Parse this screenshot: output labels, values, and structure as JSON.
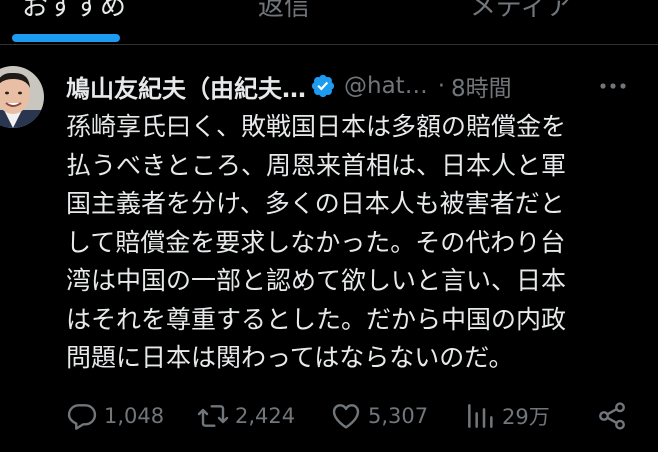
{
  "tabs": [
    {
      "label": "おすすめ"
    },
    {
      "label": "返信"
    },
    {
      "label": "メディア"
    }
  ],
  "tweet": {
    "author": {
      "display_name": "鳩山友紀夫（由紀夫…",
      "handle": "@hat…",
      "verified": true
    },
    "separator": "·",
    "timestamp": "8時間",
    "text_lines": [
      "孫崎享氏曰く、敗戦国日本は多額の賠償金を",
      "払うべきところ、周恩来首相は、日本人と軍",
      "国主義者を分け、多くの日本人も被害者だと",
      "して賠償金を要求しなかった。その代わり台",
      "湾は中国の一部と認めて欲しいと言い、日本",
      "はそれを尊重するとした。だから中国の内政",
      "問題に日本は関わってはならないのだ。"
    ],
    "stats": {
      "replies": "1,048",
      "reposts": "2,424",
      "likes": "5,307",
      "views": "29万"
    }
  },
  "icons": {
    "verified": "verified-badge-icon",
    "more": "more-options-icon",
    "reply": "reply-icon",
    "repost": "repost-icon",
    "like": "heart-icon",
    "views": "views-icon",
    "share": "share-icon"
  },
  "colors": {
    "background": "#000000",
    "text_primary": "#e7e9ea",
    "text_secondary": "#71767b",
    "accent": "#1d9bf0",
    "divider": "#2f3336"
  }
}
